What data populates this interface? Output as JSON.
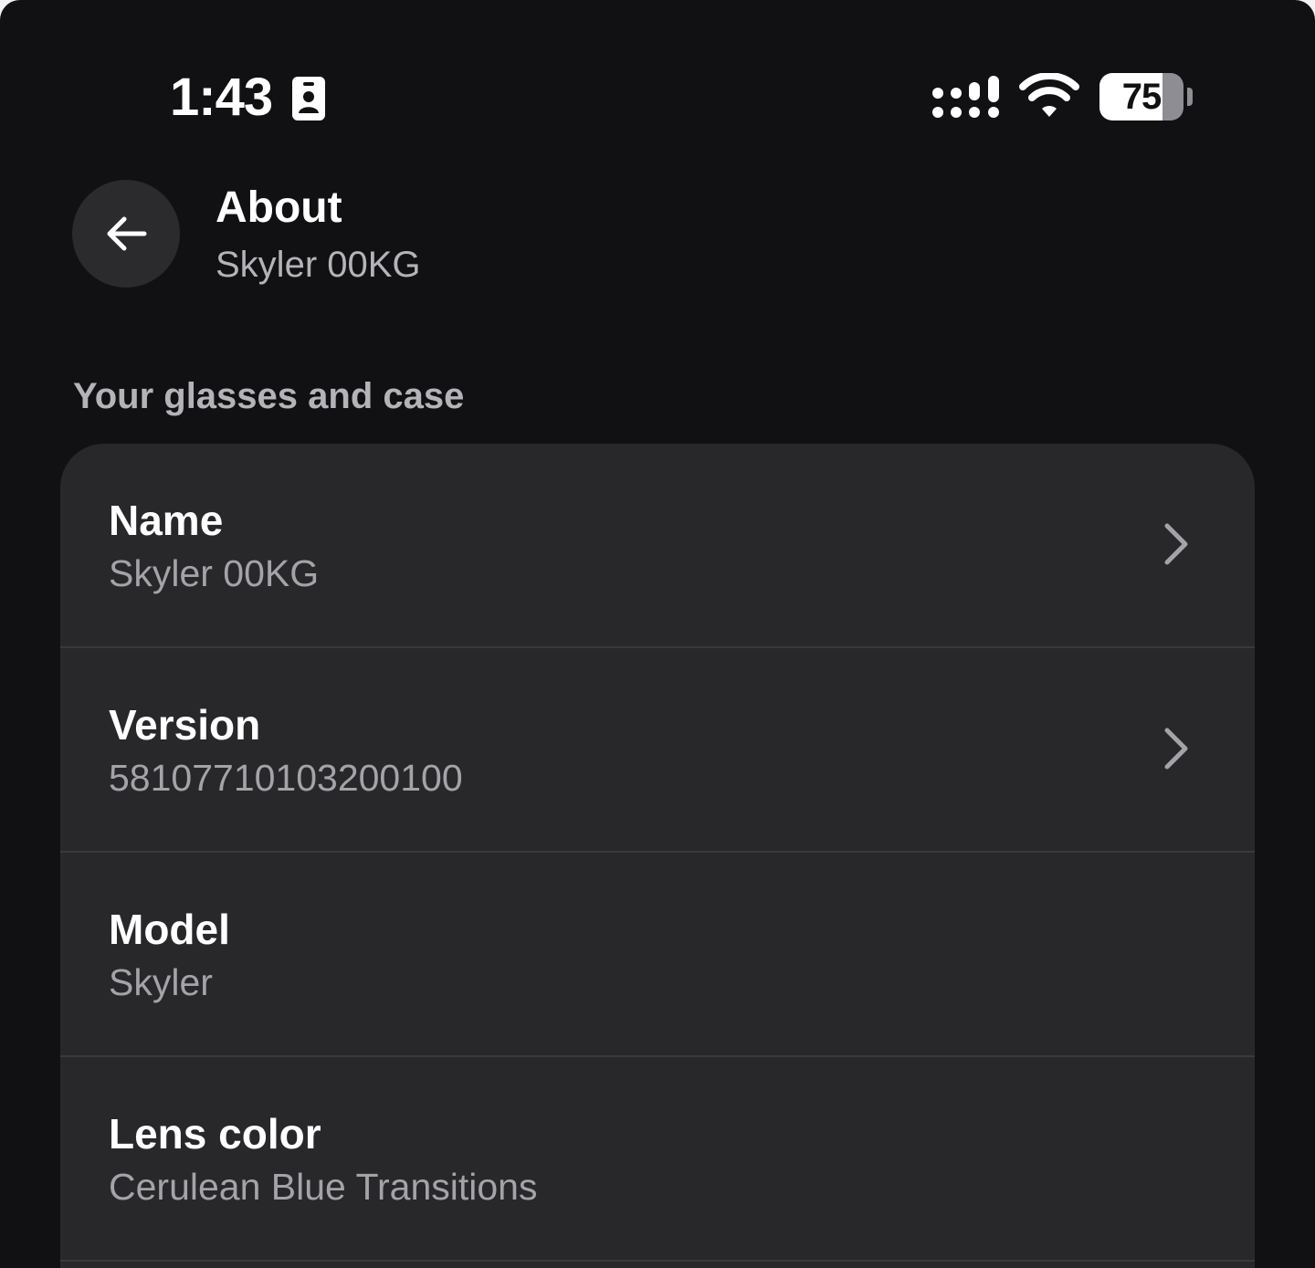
{
  "status_bar": {
    "time": "1:43",
    "battery_level": "75",
    "icons": [
      "contact-card-icon",
      "cellular-signal-icon",
      "wifi-icon",
      "battery-icon"
    ]
  },
  "header": {
    "back_icon": "arrow-left-icon",
    "title": "About",
    "subtitle": "Skyler 00KG"
  },
  "section": {
    "heading": "Your glasses and case",
    "rows": [
      {
        "label": "Name",
        "value": "Skyler 00KG",
        "has_chevron": true
      },
      {
        "label": "Version",
        "value": "5810771010320010​0",
        "has_chevron": true
      },
      {
        "label": "Model",
        "value": "Skyler",
        "has_chevron": false
      },
      {
        "label": "Lens color",
        "value": "Cerulean Blue Transitions",
        "has_chevron": false
      }
    ]
  },
  "colors": {
    "background": "#111113",
    "card": "#28282b",
    "divider": "#3a3a3e",
    "primary_text": "#ffffff",
    "secondary_text": "#a3a3a8",
    "button_bg": "#2b2b2e"
  }
}
